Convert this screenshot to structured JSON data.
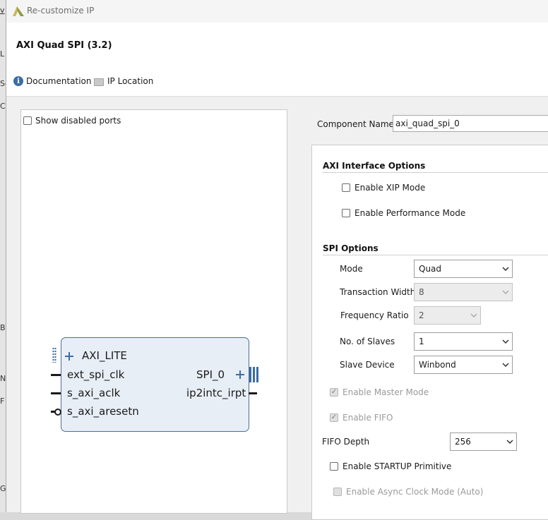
{
  "window": {
    "title": "Re-customize IP"
  },
  "background_strip": {
    "fragments": [
      "v",
      "L",
      "Se",
      "C",
      "B",
      "N",
      "F",
      "G"
    ]
  },
  "header": {
    "ip_title": "AXI Quad SPI (3.2)",
    "documentation_label": "Documentation",
    "ip_location_label": "IP Location"
  },
  "symbol_panel": {
    "show_disabled_ports_label": "Show disabled ports",
    "show_disabled_ports_checked": false,
    "block": {
      "bus_interface": "AXI_LITE",
      "left_ports": [
        "ext_spi_clk",
        "s_axi_aclk",
        "s_axi_aresetn"
      ],
      "right_ports": [
        "SPI_0",
        "ip2intc_irpt"
      ]
    }
  },
  "component": {
    "label": "Component Name",
    "value": "axi_quad_spi_0"
  },
  "axi_options": {
    "title": "AXI Interface Options",
    "enable_xip": {
      "label": "Enable XIP Mode",
      "checked": false,
      "enabled": true
    },
    "enable_performance": {
      "label": "Enable Performance Mode",
      "checked": false,
      "enabled": true
    }
  },
  "spi_options": {
    "title": "SPI Options",
    "mode": {
      "label": "Mode",
      "value": "Quad",
      "enabled": true
    },
    "transaction_width": {
      "label": "Transaction Width",
      "value": "8",
      "enabled": false
    },
    "frequency_ratio": {
      "label": "Frequency Ratio",
      "value": "2",
      "enabled": false
    },
    "no_of_slaves": {
      "label": "No. of Slaves",
      "value": "1",
      "enabled": true
    },
    "slave_device": {
      "label": "Slave Device",
      "value": "Winbond",
      "enabled": true
    },
    "enable_master_mode": {
      "label": "Enable Master Mode",
      "checked": true,
      "enabled": false
    },
    "enable_fifo": {
      "label": "Enable FIFO",
      "checked": true,
      "enabled": false
    },
    "fifo_depth": {
      "label": "FIFO Depth",
      "value": "256",
      "enabled": true
    },
    "enable_startup": {
      "label": "Enable STARTUP Primitive",
      "checked": false,
      "enabled": true
    },
    "enable_async_clock": {
      "label": "Enable Async Clock Mode (Auto)",
      "checked": false,
      "enabled": false
    }
  },
  "colors": {
    "accent": "#3a6ea5",
    "block_fill": "#e8eef6",
    "block_border": "#4c6f99",
    "disabled_text": "#9a9a9a"
  }
}
